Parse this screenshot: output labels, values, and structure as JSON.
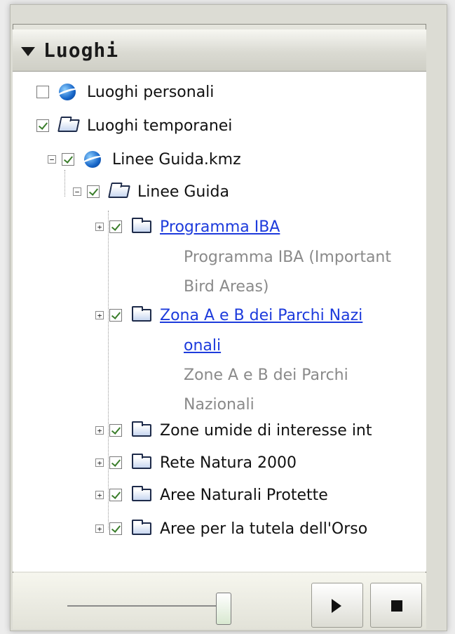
{
  "panel": {
    "title": "Luoghi"
  },
  "tree": {
    "luoghi_personali": "Luoghi personali",
    "luoghi_temporanei": "Luoghi temporanei",
    "kmz": "Linee Guida.kmz",
    "linee_guida": "Linee Guida",
    "programma_iba": "Programma IBA",
    "programma_iba_desc_1": "Programma IBA (Important",
    "programma_iba_desc_2": "Bird Areas)",
    "zona_ab_1": "Zona A e B dei Parchi Nazi",
    "zona_ab_2": "onali",
    "zona_ab_desc_1": "Zone A e B dei Parchi",
    "zona_ab_desc_2": "Nazionali",
    "zone_umide": "Zone umide di interesse int",
    "rete_natura": "Rete Natura 2000",
    "aree_naturali": "Aree Naturali Protette",
    "aree_orso": "Aree per la tutela dell'Orso"
  },
  "icons": {
    "collapse": "collapse-arrow-icon",
    "globe": "globe-icon",
    "folder": "folder-icon",
    "folder_open": "folder-open-icon",
    "play": "play-icon",
    "stop": "stop-icon"
  },
  "colors": {
    "link": "#1d3bdc",
    "description": "#8a8a8a",
    "checkmark": "#3a7d2a"
  }
}
